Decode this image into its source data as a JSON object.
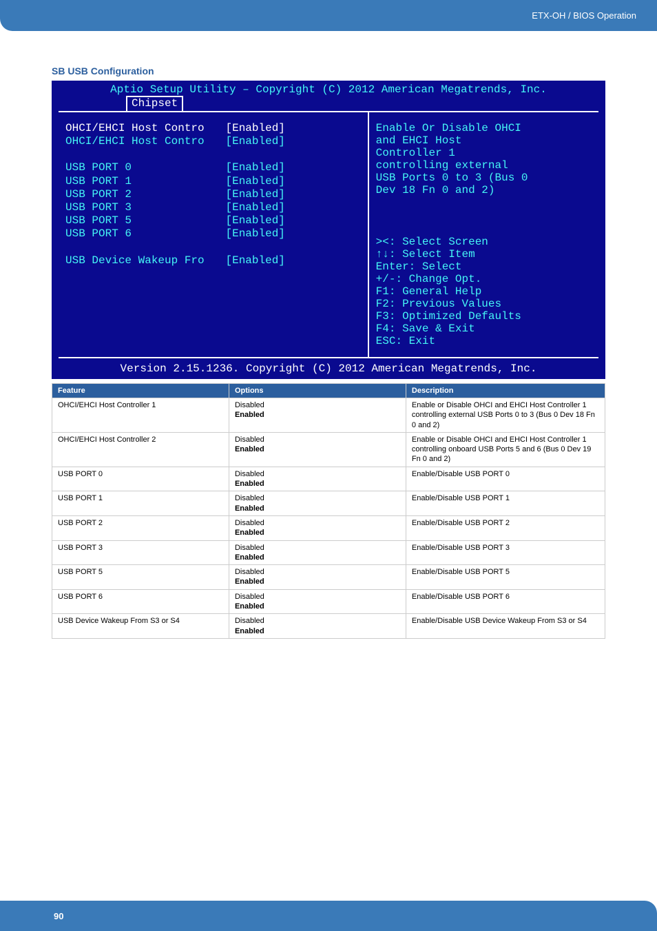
{
  "header": {
    "breadcrumb": "ETX-OH / BIOS Operation"
  },
  "section_title": "SB USB Configuration",
  "bios": {
    "title": "Aptio Setup Utility – Copyright (C) 2012 American Megatrends, Inc.",
    "tab": "Chipset",
    "items": [
      {
        "label": "OHCI/EHCI Host Contro",
        "value": "[Enabled]",
        "selected": true
      },
      {
        "label": "OHCI/EHCI Host Contro",
        "value": "[Enabled]",
        "selected": false
      }
    ],
    "ports": [
      {
        "label": "USB PORT 0",
        "value": "[Enabled]"
      },
      {
        "label": "USB PORT 1",
        "value": "[Enabled]"
      },
      {
        "label": "USB PORT 2",
        "value": "[Enabled]"
      },
      {
        "label": "USB PORT 3",
        "value": "[Enabled]"
      },
      {
        "label": "USB PORT 5",
        "value": "[Enabled]"
      },
      {
        "label": "USB PORT 6",
        "value": "[Enabled]"
      }
    ],
    "wakeup": {
      "label": "USB Device Wakeup Fro",
      "value": "[Enabled]"
    },
    "help_top": [
      "Enable Or Disable OHCI",
      "and EHCI Host",
      "Controller 1",
      "controlling external",
      "USB Ports 0 to 3 (Bus 0",
      "Dev 18 Fn 0 and 2)"
    ],
    "help_keys": [
      "><: Select Screen",
      "↑↓: Select Item",
      "Enter: Select",
      "+/-: Change Opt.",
      "F1: General Help",
      "F2: Previous Values",
      "F3: Optimized Defaults",
      "F4: Save & Exit",
      "ESC: Exit"
    ],
    "footer": "Version 2.15.1236. Copyright (C) 2012 American Megatrends, Inc."
  },
  "table": {
    "headers": {
      "c1": "Feature",
      "c2": "Options",
      "c3": "Description"
    },
    "rows": [
      {
        "feature": "OHCI/EHCI Host Controller 1",
        "opt_disabled": "Disabled",
        "opt_enabled": "Enabled",
        "desc": "Enable or Disable OHCI and EHCI Host Controller 1 controlling external USB Ports 0 to 3 (Bus 0 Dev 18 Fn 0 and 2)"
      },
      {
        "feature": "OHCI/EHCI Host Controller 2",
        "opt_disabled": "Disabled",
        "opt_enabled": "Enabled",
        "desc": "Enable or Disable OHCI and EHCI Host Controller 1 controlling onboard USB Ports 5 and 6 (Bus 0 Dev 19 Fn 0 and 2)"
      },
      {
        "feature": "USB PORT 0",
        "opt_disabled": "Disabled",
        "opt_enabled": "Enabled",
        "desc": "Enable/Disable USB PORT 0"
      },
      {
        "feature": "USB PORT 1",
        "opt_disabled": "Disabled",
        "opt_enabled": "Enabled",
        "desc": "Enable/Disable USB PORT 1"
      },
      {
        "feature": "USB PORT 2",
        "opt_disabled": "Disabled",
        "opt_enabled": "Enabled",
        "desc": "Enable/Disable USB PORT 2"
      },
      {
        "feature": "USB PORT 3",
        "opt_disabled": "Disabled",
        "opt_enabled": "Enabled",
        "desc": "Enable/Disable USB PORT 3"
      },
      {
        "feature": "USB PORT 5",
        "opt_disabled": "Disabled",
        "opt_enabled": "Enabled",
        "desc": "Enable/Disable USB PORT 5"
      },
      {
        "feature": "USB PORT 6",
        "opt_disabled": "Disabled",
        "opt_enabled": "Enabled",
        "desc": "Enable/Disable USB PORT 6"
      },
      {
        "feature": "USB Device Wakeup From S3 or S4",
        "opt_disabled": "Disabled",
        "opt_enabled": "Enabled",
        "desc": "Enable/Disable USB Device Wakeup From S3 or S4"
      }
    ]
  },
  "page_number": "90"
}
